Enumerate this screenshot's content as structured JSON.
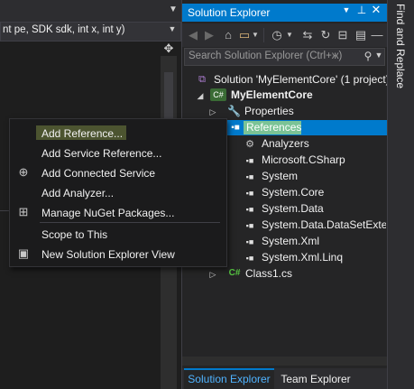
{
  "editor": {
    "member_dropdown": "nt pe, SDK sdk, int x, int y)"
  },
  "solution_explorer": {
    "title": "Solution Explorer",
    "search_placeholder": "Search Solution Explorer (Ctrl+ж)",
    "tree": {
      "solution": "Solution 'MyElementCore' (1 project)",
      "project": "MyElementCore",
      "properties": "Properties",
      "references": "References",
      "refs": [
        "Analyzers",
        "Microsoft.CSharp",
        "System",
        "System.Core",
        "System.Data",
        "System.Data.DataSetExtens",
        "System.Xml",
        "System.Xml.Linq"
      ],
      "class_file": "Class1.cs",
      "csharp_badge": "C#"
    },
    "tabs": [
      "Solution Explorer",
      "Team Explorer"
    ]
  },
  "side_strip": {
    "label": "Find and Replace"
  },
  "context_menu": {
    "items": [
      {
        "label": "Add Reference...",
        "icon": ""
      },
      {
        "label": "Add Service Reference...",
        "icon": ""
      },
      {
        "label": "Add Connected Service",
        "icon": "connected-service-icon"
      },
      {
        "label": "Add Analyzer...",
        "icon": ""
      },
      {
        "label": "Manage NuGet Packages...",
        "icon": "nuget-icon"
      },
      {
        "label": "Scope to This",
        "icon": ""
      },
      {
        "label": "New Solution Explorer View",
        "icon": "new-view-icon"
      }
    ]
  },
  "colors": {
    "accent": "#007acc",
    "highlight": "#e0ff6a",
    "background": "#1e1e1e"
  }
}
